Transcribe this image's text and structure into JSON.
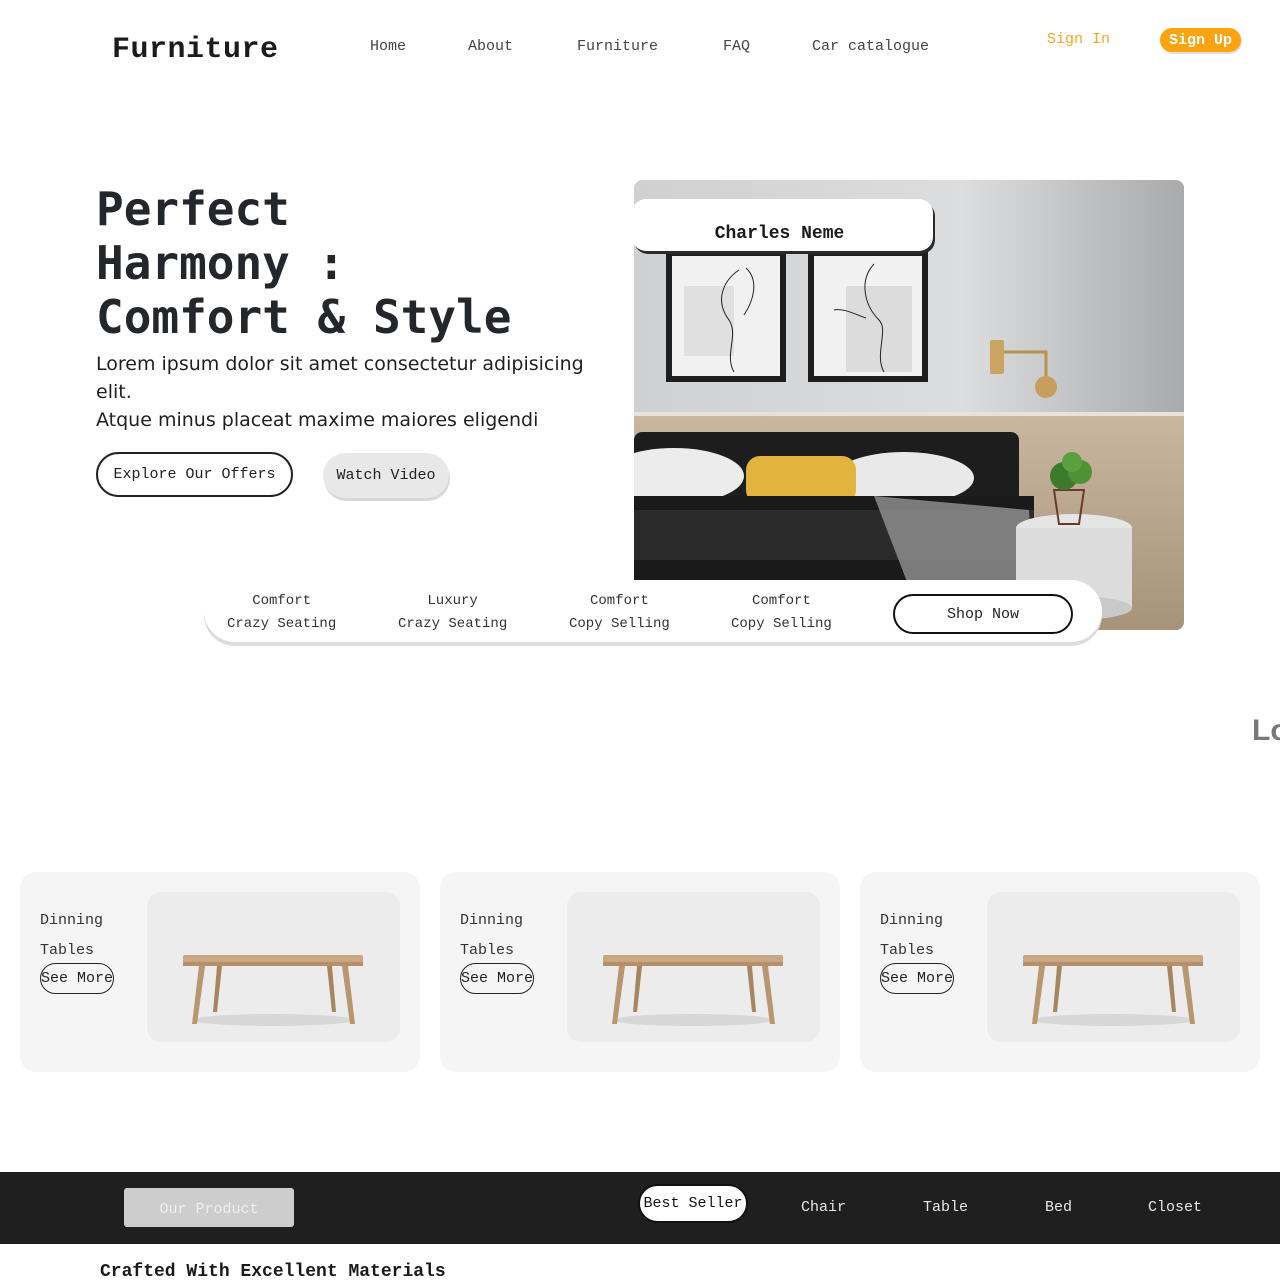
{
  "header": {
    "logo": "Furniture",
    "nav": [
      "Home",
      "About",
      "Furniture",
      "FAQ",
      "Car catalogue"
    ],
    "sign_in": "Sign In",
    "sign_up": "Sign Up"
  },
  "hero": {
    "title_lines": [
      "Perfect",
      "Harmony :",
      "Comfort & Style"
    ],
    "subtitle_lines": [
      "Lorem ipsum dolor sit amet consectetur adipisicing elit.",
      "Atque minus placeat maxime maiores eligendi"
    ],
    "explore_label": "Explore Our Offers",
    "video_label": "Watch Video",
    "card_name": "Charles Neme"
  },
  "features": [
    {
      "line1": "Comfort",
      "line2": "Crazy Seating"
    },
    {
      "line1": "Luxury",
      "line2": "Crazy Seating"
    },
    {
      "line1": "Comfort",
      "line2": "Copy Selling"
    },
    {
      "line1": "Comfort",
      "line2": "Copy Selling"
    }
  ],
  "shop_now": "Shop Now",
  "marquee_text": "Lo",
  "products": [
    {
      "line1": "Dinning",
      "line2": "Tables",
      "button": "See More"
    },
    {
      "line1": "Dinning",
      "line2": "Tables",
      "button": "See More"
    },
    {
      "line1": "Dinning",
      "line2": "Tables",
      "button": "See More"
    }
  ],
  "product_bar": {
    "our_product": "Our Product",
    "tabs": [
      "Best Seller",
      "Chair",
      "Table",
      "Bed",
      "Closet"
    ]
  },
  "crafted_heading": "Crafted With Excellent Materials",
  "colors": {
    "accent": "#fca311",
    "signin": "#f5a623",
    "dark_bar": "#1f1f1f",
    "card_bg": "#f5f5f5"
  }
}
